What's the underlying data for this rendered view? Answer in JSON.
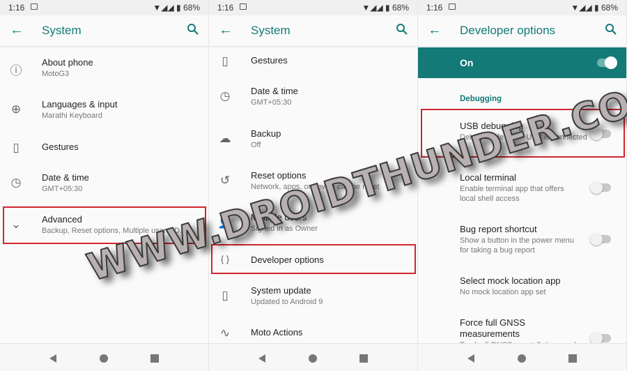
{
  "status": {
    "time": "1:16",
    "battery": "68%"
  },
  "screens": [
    {
      "title": "System",
      "items": [
        {
          "icon": "info-icon",
          "title": "About phone",
          "subtitle": "MotoG3"
        },
        {
          "icon": "globe-icon",
          "title": "Languages & input",
          "subtitle": "Marathi Keyboard"
        },
        {
          "icon": "gestures-icon",
          "title": "Gestures"
        },
        {
          "icon": "clock-icon",
          "title": "Date & time",
          "subtitle": "GMT+05:30"
        },
        {
          "icon": "chevron-down-icon",
          "title": "Advanced",
          "subtitle": "Backup, Reset options, Multiple users, D..."
        }
      ]
    },
    {
      "title": "System",
      "items": [
        {
          "icon": "gestures-icon",
          "title": "Gestures"
        },
        {
          "icon": "clock-icon",
          "title": "Date & time",
          "subtitle": "GMT+05:30"
        },
        {
          "icon": "cloud-upload-icon",
          "title": "Backup",
          "subtitle": "Off"
        },
        {
          "icon": "restore-icon",
          "title": "Reset options",
          "subtitle": "Network, apps, or device can be reset"
        },
        {
          "icon": "person-icon",
          "title": "Multiple users",
          "subtitle": "Signed in as Owner"
        },
        {
          "icon": "braces-icon",
          "title": "Developer options"
        },
        {
          "icon": "system-update-icon",
          "title": "System update",
          "subtitle": "Updated to Android 9"
        },
        {
          "icon": "moto-actions-icon",
          "title": "Moto Actions"
        }
      ]
    },
    {
      "title": "Developer options",
      "master_toggle": {
        "label": "On",
        "on": true
      },
      "section": "Debugging",
      "items": [
        {
          "title": "USB debugging",
          "subtitle": "Debug mode when USB is connected",
          "toggle": false
        },
        {
          "title": "Local terminal",
          "subtitle": "Enable terminal app that offers\nlocal shell access",
          "toggle": false
        },
        {
          "title": "Bug report shortcut",
          "subtitle": "Show a button in the power menu\nfor taking a bug report",
          "toggle": false
        },
        {
          "title": "Select mock location app",
          "subtitle": "No mock location app set"
        },
        {
          "title": "Force full GNSS\nmeasurements",
          "subtitle": "Track all GNSS constellations and",
          "toggle": false
        }
      ]
    }
  ],
  "watermark": "WWW.DROIDTHUNDER.COM",
  "colors": {
    "accent": "#137a78",
    "highlight": "#d0262e"
  }
}
